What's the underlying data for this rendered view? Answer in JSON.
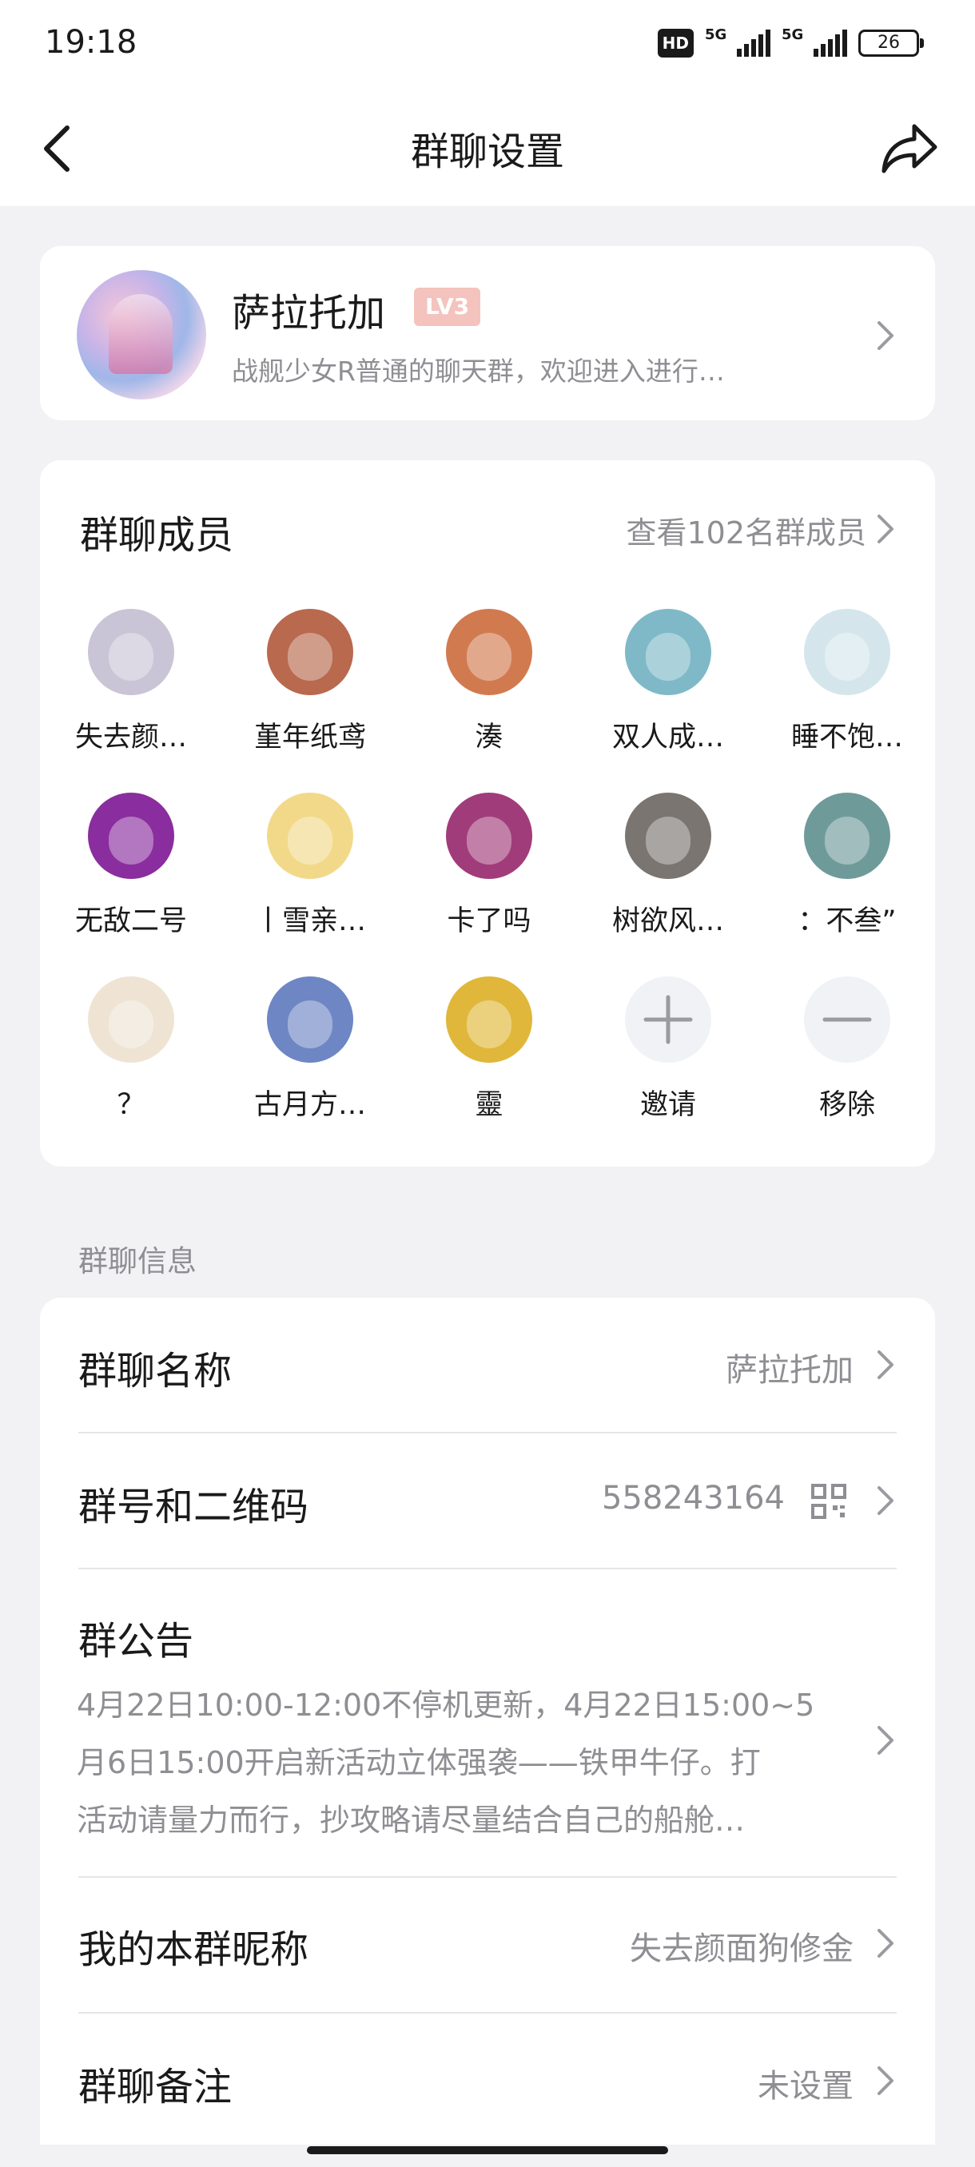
{
  "status_bar": {
    "time": "19:18",
    "hd": "HD",
    "network1": "5G",
    "network2": "5G",
    "battery": "26"
  },
  "nav": {
    "title": "群聊设置",
    "back_icon": "chevron-left-icon",
    "share_icon": "share-icon"
  },
  "group": {
    "name": "萨拉托加",
    "level": "LV3",
    "description": "战舰少女R普通的聊天群，欢迎进入进行…"
  },
  "members": {
    "title": "群聊成员",
    "view_all": "查看102名群成员",
    "list": [
      {
        "name": "失去颜…",
        "color": "#c9c4d6"
      },
      {
        "name": "堇年纸鸢",
        "color": "#b9694e"
      },
      {
        "name": "湊",
        "color": "#d27a4f"
      },
      {
        "name": "双人成…",
        "color": "#7fb9c8"
      },
      {
        "name": "睡不饱…",
        "color": "#d4e6ec"
      },
      {
        "name": "无敌二号",
        "color": "#8a2d9e"
      },
      {
        "name": "丨雪亲…",
        "color": "#f2d98a"
      },
      {
        "name": "卡了吗",
        "color": "#a13c7a"
      },
      {
        "name": "树欲风…",
        "color": "#7a7570"
      },
      {
        "name": "：不叁”",
        "color": "#6f9a9a"
      },
      {
        "name": "？",
        "color": "#efe4d4"
      },
      {
        "name": "古月方…",
        "color": "#6e86c4"
      },
      {
        "name": "靈",
        "color": "#e0b73a"
      }
    ],
    "invite_label": "邀请",
    "remove_label": "移除"
  },
  "info": {
    "section_label": "群聊信息",
    "name_title": "群聊名称",
    "name_value": "萨拉托加",
    "number_title": "群号和二维码",
    "number_value": "558243164",
    "notice_title": "群公告",
    "notice_lines": [
      "4月22日10:00-12:00不停机更新，4月22日15:00~5",
      "月6日15:00开启新活动立体强袭——铁甲牛仔。打",
      "活动请量力而行，抄攻略请尽量结合自己的船舱…"
    ],
    "nickname_title": "我的本群昵称",
    "nickname_value": "失去颜面狗修金",
    "remark_title": "群聊备注",
    "remark_value": "未设置"
  }
}
